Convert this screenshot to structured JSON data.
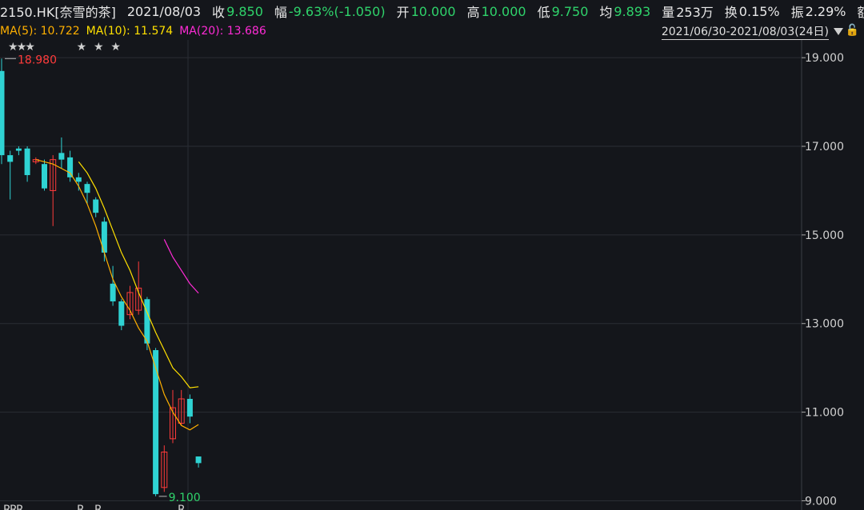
{
  "header": {
    "symbol": "2150.HK[奈雪的茶]",
    "date": "2021/08/03",
    "close_label": "收",
    "close_value": "9.850",
    "change_label": "幅",
    "change_value": "-9.63%(-1.050)",
    "open_label": "开",
    "open_value": "10.000",
    "high_label": "高",
    "high_value": "10.000",
    "low_label": "低",
    "low_value": "9.750",
    "avg_label": "均",
    "avg_value": "9.893",
    "volume_label": "量",
    "volume_value": "253万",
    "turnover_label": "换",
    "turnover_value": "0.15%",
    "amplitude_label": "振",
    "amplitude_value": "2.29%",
    "amount_label": "额",
    "more": "..."
  },
  "ma": {
    "ma5": "MA(5): 10.722",
    "ma10": "MA(10): 11.574",
    "ma20": "MA(20): 13.686"
  },
  "range": {
    "text": "2021/06/30-2021/08/03(24日)"
  },
  "colors": {
    "up": "#ff3b3b",
    "down": "#2fd3d3",
    "ma5": "#ffb000",
    "ma10": "#ffe000",
    "ma20": "#ff2bd6",
    "grid": "#2a2d34"
  },
  "chart_data": {
    "type": "candlestick",
    "y_ticks": [
      "19.000",
      "17.000",
      "15.000",
      "13.000",
      "11.000",
      "9.000"
    ],
    "ylim": [
      8.9,
      19.4
    ],
    "annotations": {
      "high": "18.980",
      "low": "9.100"
    },
    "candles": [
      {
        "o": 18.7,
        "c": 16.8,
        "h": 18.98,
        "l": 16.6
      },
      {
        "o": 16.8,
        "c": 16.65,
        "h": 16.9,
        "l": 15.8
      },
      {
        "o": 16.95,
        "c": 16.9,
        "h": 17.0,
        "l": 16.8
      },
      {
        "o": 16.95,
        "c": 16.35,
        "h": 17.0,
        "l": 16.2
      },
      {
        "o": 16.65,
        "c": 16.7,
        "h": 16.75,
        "l": 16.6
      },
      {
        "o": 16.6,
        "c": 16.05,
        "h": 16.7,
        "l": 16.0
      },
      {
        "o": 16.0,
        "c": 16.7,
        "h": 16.8,
        "l": 15.2
      },
      {
        "o": 16.85,
        "c": 16.7,
        "h": 17.2,
        "l": 16.5
      },
      {
        "o": 16.75,
        "c": 16.3,
        "h": 16.9,
        "l": 16.2
      },
      {
        "o": 16.3,
        "c": 16.2,
        "h": 16.4,
        "l": 16.0
      },
      {
        "o": 16.15,
        "c": 15.95,
        "h": 16.2,
        "l": 15.7
      },
      {
        "o": 15.8,
        "c": 15.5,
        "h": 15.85,
        "l": 15.4
      },
      {
        "o": 15.3,
        "c": 14.6,
        "h": 15.4,
        "l": 14.4
      },
      {
        "o": 13.9,
        "c": 13.5,
        "h": 14.3,
        "l": 13.4
      },
      {
        "o": 13.5,
        "c": 12.95,
        "h": 13.55,
        "l": 12.85
      },
      {
        "o": 13.2,
        "c": 13.7,
        "h": 13.85,
        "l": 13.1
      },
      {
        "o": 13.3,
        "c": 13.8,
        "h": 14.4,
        "l": 13.2
      },
      {
        "o": 13.55,
        "c": 12.55,
        "h": 13.6,
        "l": 12.4
      },
      {
        "o": 12.4,
        "c": 9.15,
        "h": 12.45,
        "l": 9.1
      },
      {
        "o": 9.3,
        "c": 10.1,
        "h": 10.25,
        "l": 9.2
      },
      {
        "o": 10.4,
        "c": 11.1,
        "h": 11.5,
        "l": 10.3
      },
      {
        "o": 10.75,
        "c": 11.3,
        "h": 11.5,
        "l": 10.7
      },
      {
        "o": 11.3,
        "c": 10.9,
        "h": 11.4,
        "l": 10.75
      },
      {
        "o": 10.0,
        "c": 9.85,
        "h": 10.0,
        "l": 9.75
      }
    ],
    "ma5": [
      null,
      null,
      null,
      null,
      16.7,
      16.65,
      16.6,
      16.5,
      16.4,
      16.1,
      15.7,
      15.2,
      14.6,
      14.0,
      13.6,
      13.3,
      12.9,
      12.6,
      12.0,
      11.4,
      11.0,
      10.7,
      10.6,
      10.72
    ],
    "ma10": [
      null,
      null,
      null,
      null,
      null,
      null,
      null,
      null,
      null,
      16.65,
      16.4,
      16.05,
      15.6,
      15.1,
      14.6,
      14.2,
      13.7,
      13.25,
      12.8,
      12.4,
      12.0,
      11.8,
      11.55,
      11.574
    ],
    "ma20": [
      null,
      null,
      null,
      null,
      null,
      null,
      null,
      null,
      null,
      null,
      null,
      null,
      null,
      null,
      null,
      null,
      null,
      null,
      null,
      14.9,
      14.5,
      14.2,
      13.9,
      13.686
    ],
    "stars_above": [
      0,
      1,
      2,
      8,
      10,
      12
    ],
    "bottom_markers": [
      "R",
      "R",
      "R",
      "R",
      "R",
      "R"
    ]
  }
}
